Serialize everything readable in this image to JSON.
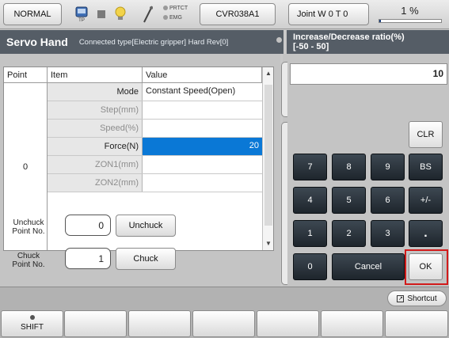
{
  "topbar": {
    "mode": "NORMAL",
    "tp_label": "TP",
    "prtct": "PRTCT",
    "emg": "EMG",
    "robot": "CVR038A1",
    "joint": "Joint W 0 T 0",
    "speed": "1 %",
    "speed_value": 1
  },
  "header": {
    "title": "Servo Hand",
    "info": "Connected type[Electric gripper]  Hard Rev[0]"
  },
  "table": {
    "columns": [
      "Point",
      "Item",
      "Value"
    ],
    "point": "0",
    "rows": [
      {
        "item": "Mode",
        "value": "Constant Speed(Open)"
      },
      {
        "item": "Step(mm)",
        "value": ""
      },
      {
        "item": "Speed(%)",
        "value": ""
      },
      {
        "item": "Force(N)",
        "value": "20"
      },
      {
        "item": "ZON1(mm)",
        "value": ""
      },
      {
        "item": "ZON2(mm)",
        "value": ""
      }
    ]
  },
  "unchuck": {
    "label_line1": "Unchuck",
    "label_line2": "Point No.",
    "value": "0",
    "button": "Unchuck"
  },
  "chuck": {
    "label_line1": "Chuck",
    "label_line2": "Point No.",
    "value": "1",
    "button": "Chuck"
  },
  "keypad": {
    "title": "Increase/Decrease ratio(%)",
    "range": "[-50 - 50]",
    "display": "10",
    "clr": "CLR",
    "keys": [
      "7",
      "8",
      "9",
      "BS",
      "4",
      "5",
      "6",
      "+/-",
      "1",
      "2",
      "3",
      "."
    ],
    "zero": "0",
    "cancel": "Cancel",
    "ok": "OK"
  },
  "shortcut": "Shortcut",
  "bottom": {
    "shift": "SHIFT"
  },
  "colors": {
    "selection": "#0a78d6",
    "header": "#555d66",
    "key": "#262e36",
    "highlight": "#d21a1a"
  }
}
